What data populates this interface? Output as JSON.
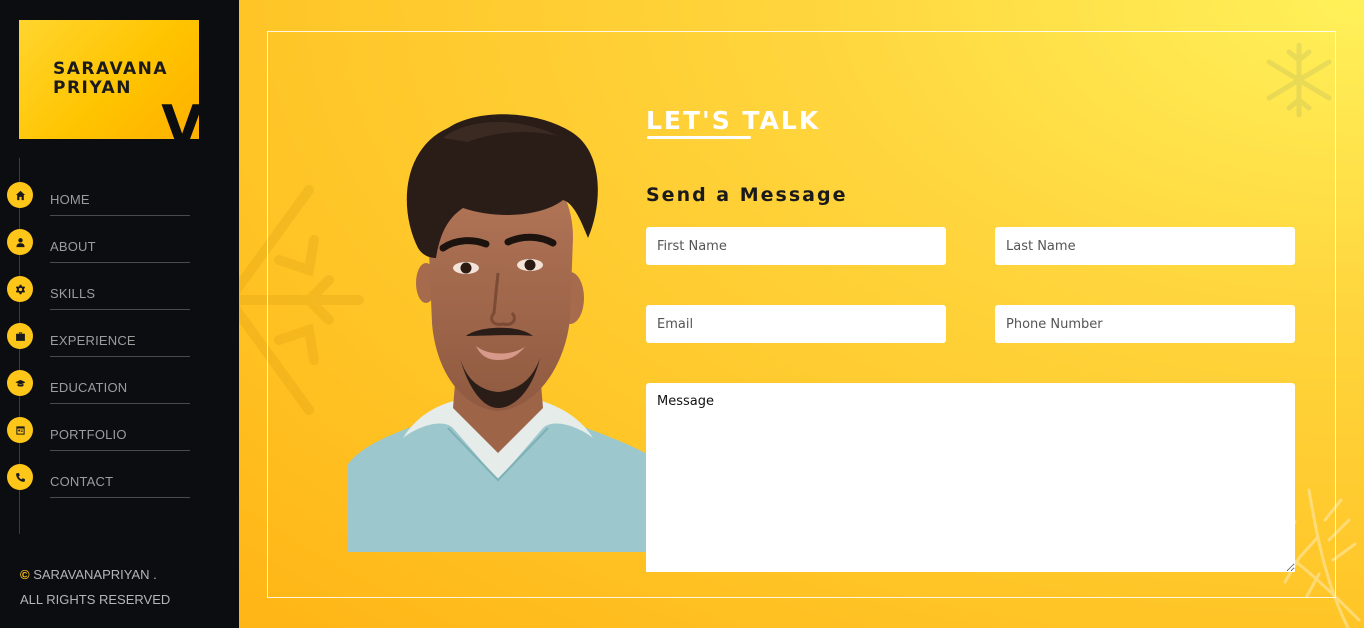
{
  "sidebar": {
    "logo": {
      "text": "SARAVANA\nPRIYAN",
      "mark": "V"
    },
    "items": [
      {
        "label": "HOME",
        "icon": "home-icon"
      },
      {
        "label": "ABOUT",
        "icon": "user-icon"
      },
      {
        "label": "SKILLS",
        "icon": "gear-icon"
      },
      {
        "label": "EXPERIENCE",
        "icon": "briefcase-icon"
      },
      {
        "label": "EDUCATION",
        "icon": "graduation-cap-icon"
      },
      {
        "label": "PORTFOLIO",
        "icon": "portfolio-icon"
      },
      {
        "label": "CONTACT",
        "icon": "phone-icon"
      }
    ],
    "copyright": {
      "symbol": "©",
      "name": " SARAVANAPRIYAN .",
      "rights": "ALL RIGHTS RESERVED"
    }
  },
  "contact": {
    "heading": "LET'S TALK",
    "subheading": "Send a Message",
    "fields": {
      "first_name": "First Name",
      "last_name": "Last Name",
      "email": "Email",
      "phone": "Phone Number",
      "message": "Message"
    }
  },
  "colors": {
    "accent": "#ffc61a",
    "sidebar_bg": "#0c0d11",
    "main_bg": "#ffc527"
  }
}
